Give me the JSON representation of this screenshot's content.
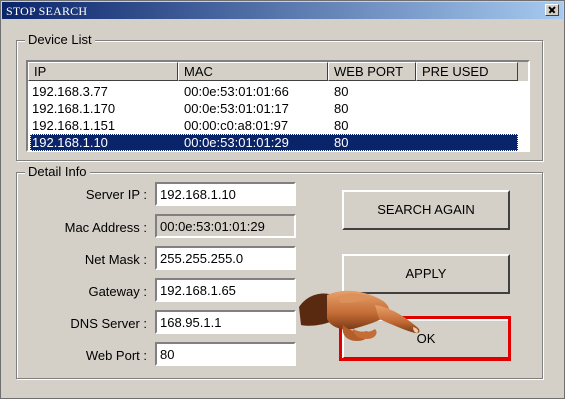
{
  "window": {
    "title": "STOP SEARCH"
  },
  "device_list": {
    "legend": "Device List",
    "columns": [
      "IP",
      "MAC",
      "WEB PORT",
      "PRE USED"
    ],
    "rows": [
      {
        "ip": "192.168.3.77",
        "mac": "00:0e:53:01:01:66",
        "port": "80",
        "pre_used": ""
      },
      {
        "ip": "192.168.1.170",
        "mac": "00:0e:53:01:01:17",
        "port": "80",
        "pre_used": ""
      },
      {
        "ip": "192.168.1.151",
        "mac": "00:00:c0:a8:01:97",
        "port": "80",
        "pre_used": ""
      },
      {
        "ip": "192.168.1.10",
        "mac": "00:0e:53:01:01:29",
        "port": "80",
        "pre_used": ""
      }
    ],
    "selected_index": 3
  },
  "detail": {
    "legend": "Detail Info",
    "server_ip_label": "Server IP :",
    "server_ip": "192.168.1.10",
    "mac_label": "Mac Address :",
    "mac": "00:0e:53:01:01:29",
    "netmask_label": "Net Mask :",
    "netmask": "255.255.255.0",
    "gateway_label": "Gateway :",
    "gateway": "192.168.1.65",
    "dns_label": "DNS Server :",
    "dns": "168.95.1.1",
    "webport_label": "Web Port :",
    "webport": "80"
  },
  "buttons": {
    "search_again": "SEARCH AGAIN",
    "apply": "APPLY",
    "ok": "OK"
  },
  "highlight_color": "#e00000",
  "selection_color": "#0a246a"
}
